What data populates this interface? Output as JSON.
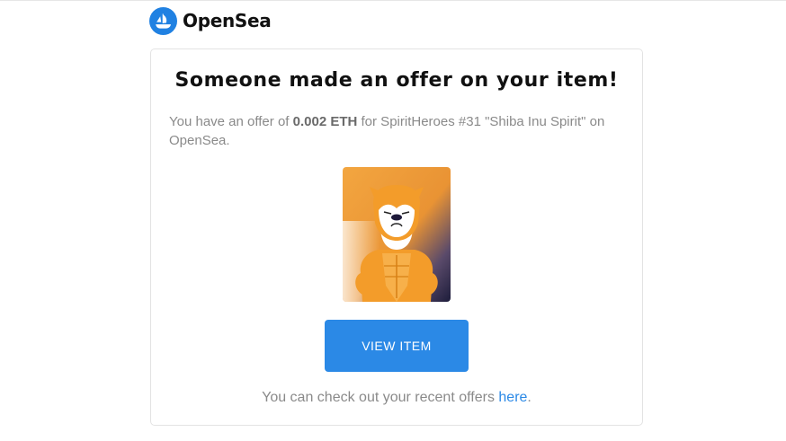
{
  "brand": {
    "name": "OpenSea",
    "icon": "opensea-logo-icon",
    "accent_color": "#2081e2"
  },
  "email": {
    "title": "Someone made an offer on your item!",
    "offer_prefix": "You have an offer of ",
    "offer_amount": "0.002 ETH",
    "offer_middle": " for SpiritHeroes #31 \"Shiba Inu Spirit\" on OpenSea.",
    "item_image_alt": "SpiritHeroes #31 Shiba Inu Spirit",
    "button_label": "VIEW ITEM",
    "button_color": "#2b89e6",
    "footer_prefix": "You can check out your recent offers ",
    "footer_link": "here",
    "footer_suffix": "."
  }
}
